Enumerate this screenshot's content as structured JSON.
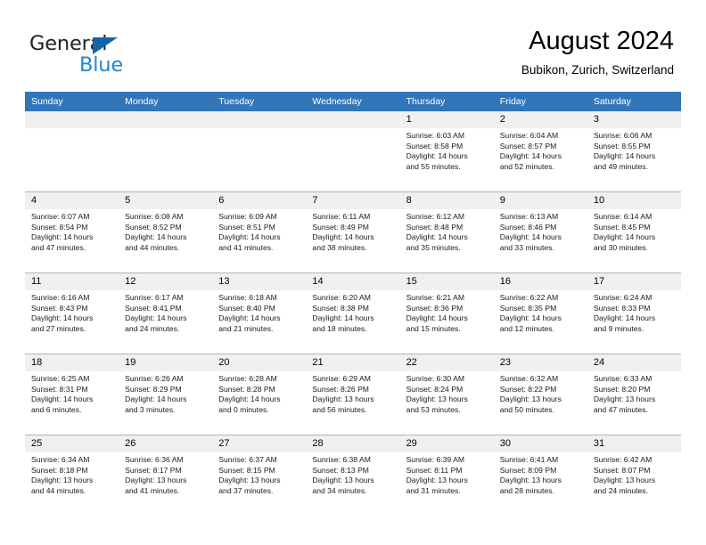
{
  "brand": {
    "name_part1": "General",
    "name_part2": "Blue",
    "flag_icon": "triangle-flag-icon"
  },
  "header": {
    "title": "August 2024",
    "subtitle": "Bubikon, Zurich, Switzerland"
  },
  "colors": {
    "header_row_bg": "#3276b8",
    "day_number_bg": "#f0f0f0",
    "brand_blue": "#1e87d6",
    "brand_flag": "#1464aa",
    "grid_line": "#b3b3b3",
    "text": "#000000"
  },
  "weekday_headers": [
    "Sunday",
    "Monday",
    "Tuesday",
    "Wednesday",
    "Thursday",
    "Friday",
    "Saturday"
  ],
  "labels": {
    "sunrise_prefix": "Sunrise:",
    "sunset_prefix": "Sunset:",
    "daylight_prefix": "Daylight:"
  },
  "weeks": [
    [
      {
        "day": "",
        "empty": true
      },
      {
        "day": "",
        "empty": true
      },
      {
        "day": "",
        "empty": true
      },
      {
        "day": "",
        "empty": true
      },
      {
        "day": "1",
        "sunrise": "Sunrise: 6:03 AM",
        "sunset": "Sunset: 8:58 PM",
        "daylight_line1": "Daylight: 14 hours",
        "daylight_line2": "and 55 minutes."
      },
      {
        "day": "2",
        "sunrise": "Sunrise: 6:04 AM",
        "sunset": "Sunset: 8:57 PM",
        "daylight_line1": "Daylight: 14 hours",
        "daylight_line2": "and 52 minutes."
      },
      {
        "day": "3",
        "sunrise": "Sunrise: 6:06 AM",
        "sunset": "Sunset: 8:55 PM",
        "daylight_line1": "Daylight: 14 hours",
        "daylight_line2": "and 49 minutes."
      }
    ],
    [
      {
        "day": "4",
        "sunrise": "Sunrise: 6:07 AM",
        "sunset": "Sunset: 8:54 PM",
        "daylight_line1": "Daylight: 14 hours",
        "daylight_line2": "and 47 minutes."
      },
      {
        "day": "5",
        "sunrise": "Sunrise: 6:08 AM",
        "sunset": "Sunset: 8:52 PM",
        "daylight_line1": "Daylight: 14 hours",
        "daylight_line2": "and 44 minutes."
      },
      {
        "day": "6",
        "sunrise": "Sunrise: 6:09 AM",
        "sunset": "Sunset: 8:51 PM",
        "daylight_line1": "Daylight: 14 hours",
        "daylight_line2": "and 41 minutes."
      },
      {
        "day": "7",
        "sunrise": "Sunrise: 6:11 AM",
        "sunset": "Sunset: 8:49 PM",
        "daylight_line1": "Daylight: 14 hours",
        "daylight_line2": "and 38 minutes."
      },
      {
        "day": "8",
        "sunrise": "Sunrise: 6:12 AM",
        "sunset": "Sunset: 8:48 PM",
        "daylight_line1": "Daylight: 14 hours",
        "daylight_line2": "and 35 minutes."
      },
      {
        "day": "9",
        "sunrise": "Sunrise: 6:13 AM",
        "sunset": "Sunset: 8:46 PM",
        "daylight_line1": "Daylight: 14 hours",
        "daylight_line2": "and 33 minutes."
      },
      {
        "day": "10",
        "sunrise": "Sunrise: 6:14 AM",
        "sunset": "Sunset: 8:45 PM",
        "daylight_line1": "Daylight: 14 hours",
        "daylight_line2": "and 30 minutes."
      }
    ],
    [
      {
        "day": "11",
        "sunrise": "Sunrise: 6:16 AM",
        "sunset": "Sunset: 8:43 PM",
        "daylight_line1": "Daylight: 14 hours",
        "daylight_line2": "and 27 minutes."
      },
      {
        "day": "12",
        "sunrise": "Sunrise: 6:17 AM",
        "sunset": "Sunset: 8:41 PM",
        "daylight_line1": "Daylight: 14 hours",
        "daylight_line2": "and 24 minutes."
      },
      {
        "day": "13",
        "sunrise": "Sunrise: 6:18 AM",
        "sunset": "Sunset: 8:40 PM",
        "daylight_line1": "Daylight: 14 hours",
        "daylight_line2": "and 21 minutes."
      },
      {
        "day": "14",
        "sunrise": "Sunrise: 6:20 AM",
        "sunset": "Sunset: 8:38 PM",
        "daylight_line1": "Daylight: 14 hours",
        "daylight_line2": "and 18 minutes."
      },
      {
        "day": "15",
        "sunrise": "Sunrise: 6:21 AM",
        "sunset": "Sunset: 8:36 PM",
        "daylight_line1": "Daylight: 14 hours",
        "daylight_line2": "and 15 minutes."
      },
      {
        "day": "16",
        "sunrise": "Sunrise: 6:22 AM",
        "sunset": "Sunset: 8:35 PM",
        "daylight_line1": "Daylight: 14 hours",
        "daylight_line2": "and 12 minutes."
      },
      {
        "day": "17",
        "sunrise": "Sunrise: 6:24 AM",
        "sunset": "Sunset: 8:33 PM",
        "daylight_line1": "Daylight: 14 hours",
        "daylight_line2": "and 9 minutes."
      }
    ],
    [
      {
        "day": "18",
        "sunrise": "Sunrise: 6:25 AM",
        "sunset": "Sunset: 8:31 PM",
        "daylight_line1": "Daylight: 14 hours",
        "daylight_line2": "and 6 minutes."
      },
      {
        "day": "19",
        "sunrise": "Sunrise: 6:26 AM",
        "sunset": "Sunset: 8:29 PM",
        "daylight_line1": "Daylight: 14 hours",
        "daylight_line2": "and 3 minutes."
      },
      {
        "day": "20",
        "sunrise": "Sunrise: 6:28 AM",
        "sunset": "Sunset: 8:28 PM",
        "daylight_line1": "Daylight: 14 hours",
        "daylight_line2": "and 0 minutes."
      },
      {
        "day": "21",
        "sunrise": "Sunrise: 6:29 AM",
        "sunset": "Sunset: 8:26 PM",
        "daylight_line1": "Daylight: 13 hours",
        "daylight_line2": "and 56 minutes."
      },
      {
        "day": "22",
        "sunrise": "Sunrise: 6:30 AM",
        "sunset": "Sunset: 8:24 PM",
        "daylight_line1": "Daylight: 13 hours",
        "daylight_line2": "and 53 minutes."
      },
      {
        "day": "23",
        "sunrise": "Sunrise: 6:32 AM",
        "sunset": "Sunset: 8:22 PM",
        "daylight_line1": "Daylight: 13 hours",
        "daylight_line2": "and 50 minutes."
      },
      {
        "day": "24",
        "sunrise": "Sunrise: 6:33 AM",
        "sunset": "Sunset: 8:20 PM",
        "daylight_line1": "Daylight: 13 hours",
        "daylight_line2": "and 47 minutes."
      }
    ],
    [
      {
        "day": "25",
        "sunrise": "Sunrise: 6:34 AM",
        "sunset": "Sunset: 8:18 PM",
        "daylight_line1": "Daylight: 13 hours",
        "daylight_line2": "and 44 minutes."
      },
      {
        "day": "26",
        "sunrise": "Sunrise: 6:36 AM",
        "sunset": "Sunset: 8:17 PM",
        "daylight_line1": "Daylight: 13 hours",
        "daylight_line2": "and 41 minutes."
      },
      {
        "day": "27",
        "sunrise": "Sunrise: 6:37 AM",
        "sunset": "Sunset: 8:15 PM",
        "daylight_line1": "Daylight: 13 hours",
        "daylight_line2": "and 37 minutes."
      },
      {
        "day": "28",
        "sunrise": "Sunrise: 6:38 AM",
        "sunset": "Sunset: 8:13 PM",
        "daylight_line1": "Daylight: 13 hours",
        "daylight_line2": "and 34 minutes."
      },
      {
        "day": "29",
        "sunrise": "Sunrise: 6:39 AM",
        "sunset": "Sunset: 8:11 PM",
        "daylight_line1": "Daylight: 13 hours",
        "daylight_line2": "and 31 minutes."
      },
      {
        "day": "30",
        "sunrise": "Sunrise: 6:41 AM",
        "sunset": "Sunset: 8:09 PM",
        "daylight_line1": "Daylight: 13 hours",
        "daylight_line2": "and 28 minutes."
      },
      {
        "day": "31",
        "sunrise": "Sunrise: 6:42 AM",
        "sunset": "Sunset: 8:07 PM",
        "daylight_line1": "Daylight: 13 hours",
        "daylight_line2": "and 24 minutes."
      }
    ]
  ]
}
